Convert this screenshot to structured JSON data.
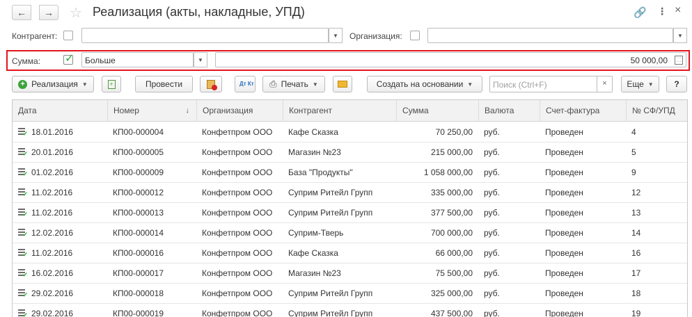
{
  "window": {
    "title": "Реализация (акты, накладные, УПД)"
  },
  "filters": {
    "counterparty_label": "Контрагент:",
    "counterparty_value": "",
    "organization_label": "Организация:",
    "organization_value": "",
    "sum_label": "Сумма:",
    "sum_checked": true,
    "sum_condition": "Больше",
    "sum_value": "50 000,00"
  },
  "toolbar": {
    "realization_label": "Реализация",
    "post_label": "Провести",
    "print_label": "Печать",
    "dt_kt_label": "Дт Кт",
    "create_based_label": "Создать на основании",
    "search_placeholder": "Поиск (Ctrl+F)",
    "more_label": "Еще",
    "help_label": "?"
  },
  "table": {
    "columns": [
      "Дата",
      "Номер",
      "Организация",
      "Контрагент",
      "Сумма",
      "Валюта",
      "Счет-фактура",
      "№ СФ/УПД"
    ],
    "sort_column": "Номер",
    "sort_icon": "sort-desc-icon",
    "rows": [
      {
        "date": "18.01.2016",
        "number": "КП00-000004",
        "org": "Конфетпром ООО",
        "counterparty": "Кафе Сказка",
        "sum": "70 250,00",
        "currency": "руб.",
        "invoice": "Проведен",
        "inv_no": "4"
      },
      {
        "date": "20.01.2016",
        "number": "КП00-000005",
        "org": "Конфетпром ООО",
        "counterparty": "Магазин №23",
        "sum": "215 000,00",
        "currency": "руб.",
        "invoice": "Проведен",
        "inv_no": "5"
      },
      {
        "date": "01.02.2016",
        "number": "КП00-000009",
        "org": "Конфетпром ООО",
        "counterparty": "База \"Продукты\"",
        "sum": "1 058 000,00",
        "currency": "руб.",
        "invoice": "Проведен",
        "inv_no": "9"
      },
      {
        "date": "11.02.2016",
        "number": "КП00-000012",
        "org": "Конфетпром ООО",
        "counterparty": "Суприм Ритейл Групп",
        "sum": "335 000,00",
        "currency": "руб.",
        "invoice": "Проведен",
        "inv_no": "12"
      },
      {
        "date": "11.02.2016",
        "number": "КП00-000013",
        "org": "Конфетпром ООО",
        "counterparty": "Суприм Ритейл Групп",
        "sum": "377 500,00",
        "currency": "руб.",
        "invoice": "Проведен",
        "inv_no": "13"
      },
      {
        "date": "12.02.2016",
        "number": "КП00-000014",
        "org": "Конфетпром ООО",
        "counterparty": "Суприм-Тверь",
        "sum": "700 000,00",
        "currency": "руб.",
        "invoice": "Проведен",
        "inv_no": "14"
      },
      {
        "date": "11.02.2016",
        "number": "КП00-000016",
        "org": "Конфетпром ООО",
        "counterparty": "Кафе Сказка",
        "sum": "66 000,00",
        "currency": "руб.",
        "invoice": "Проведен",
        "inv_no": "16"
      },
      {
        "date": "16.02.2016",
        "number": "КП00-000017",
        "org": "Конфетпром ООО",
        "counterparty": "Магазин №23",
        "sum": "75 500,00",
        "currency": "руб.",
        "invoice": "Проведен",
        "inv_no": "17"
      },
      {
        "date": "29.02.2016",
        "number": "КП00-000018",
        "org": "Конфетпром ООО",
        "counterparty": "Суприм Ритейл Групп",
        "sum": "325 000,00",
        "currency": "руб.",
        "invoice": "Проведен",
        "inv_no": "18"
      },
      {
        "date": "29.02.2016",
        "number": "КП00-000019",
        "org": "Конфетпром ООО",
        "counterparty": "Суприм Ритейл Групп",
        "sum": "437 500,00",
        "currency": "руб.",
        "invoice": "Проведен",
        "inv_no": "19"
      }
    ]
  }
}
